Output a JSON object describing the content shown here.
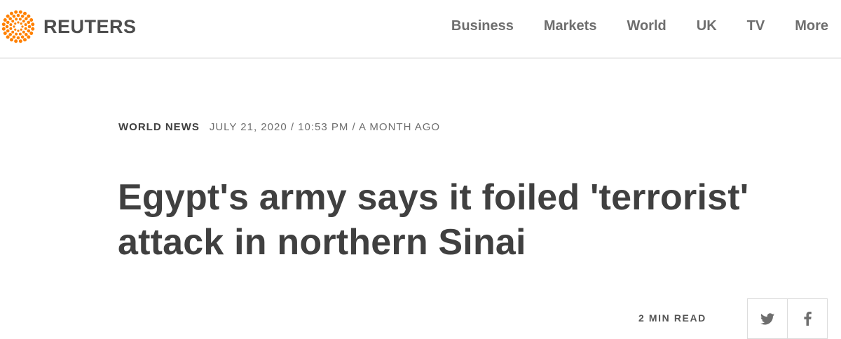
{
  "brand": {
    "name": "REUTERS",
    "accent_color": "#ff8000"
  },
  "nav": {
    "items": [
      {
        "label": "Business"
      },
      {
        "label": "Markets"
      },
      {
        "label": "World"
      },
      {
        "label": "UK"
      },
      {
        "label": "TV"
      },
      {
        "label": "More"
      }
    ]
  },
  "article": {
    "section": "WORLD NEWS",
    "dateline": "JULY 21, 2020 / 10:53 PM / A MONTH AGO",
    "headline": "Egypt's army says it foiled 'terrorist' attack in northern Sinai",
    "read_time": "2 MIN READ"
  },
  "share": {
    "buttons": [
      {
        "icon": "twitter-icon"
      },
      {
        "icon": "facebook-icon"
      }
    ]
  }
}
